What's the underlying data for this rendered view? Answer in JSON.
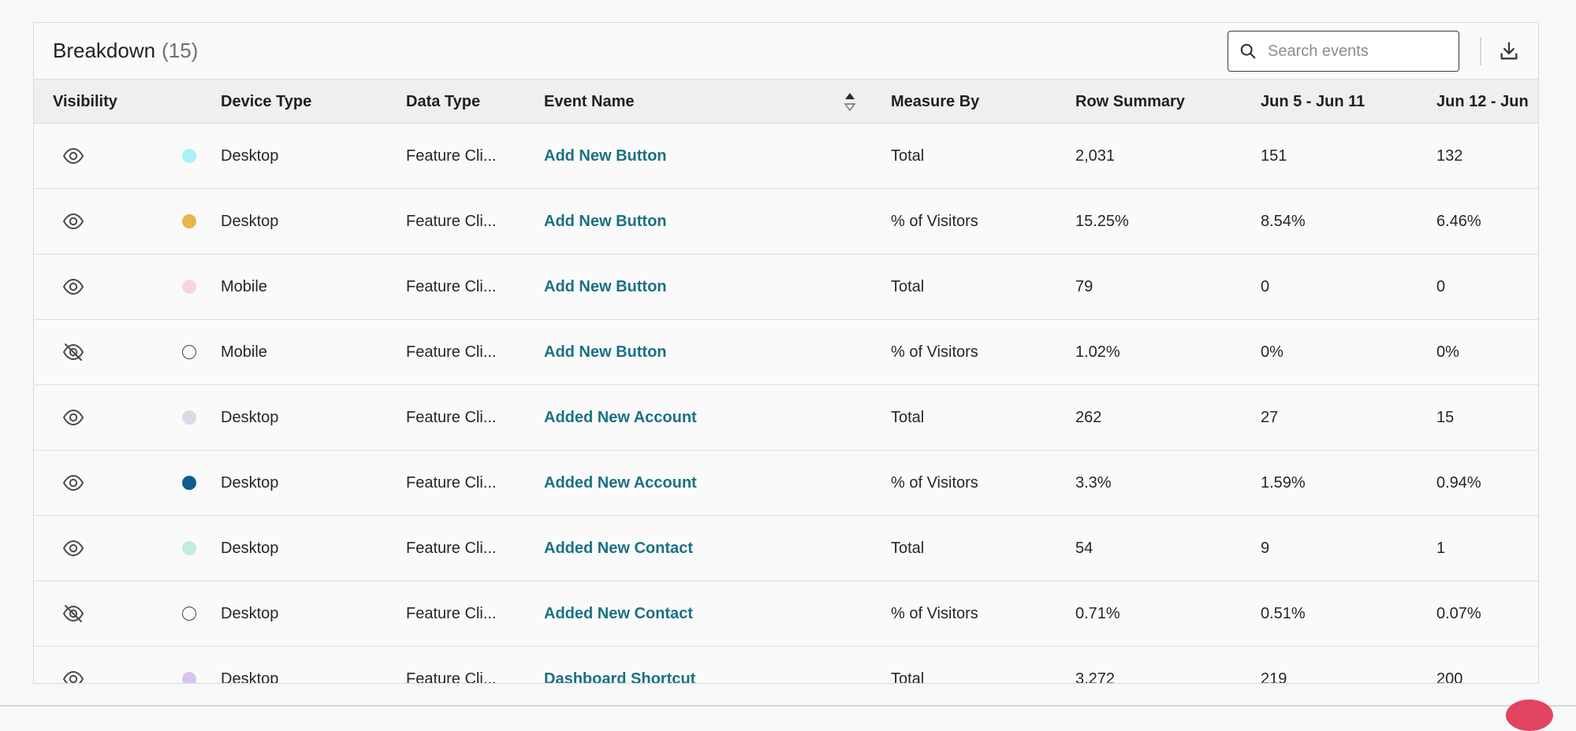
{
  "header": {
    "title": "Breakdown",
    "count": "(15)",
    "search_placeholder": "Search events",
    "search_value": ""
  },
  "columns": {
    "visibility": "Visibility",
    "device_type": "Device Type",
    "data_type": "Data Type",
    "event_name": "Event Name",
    "measure_by": "Measure By",
    "row_summary": "Row Summary",
    "week1": "Jun 5 - Jun 11",
    "week2": "Jun 12 - Jun"
  },
  "icons": {
    "search": "search-icon",
    "download": "download-icon",
    "sort": "sort-icon",
    "visible": "eye-icon",
    "hidden": "eye-off-icon"
  },
  "colors": {
    "link": "#1a7182",
    "header_bg": "#eeeff1"
  },
  "rows": [
    {
      "visible": true,
      "color": "#a8f2f7",
      "hollow": false,
      "device": "Desktop",
      "data_type": "Feature Cli...",
      "event": "Add New Button",
      "measure": "Total",
      "summary": "2,031",
      "w1": "151",
      "w2": "132"
    },
    {
      "visible": true,
      "color": "#e9b54a",
      "hollow": false,
      "device": "Desktop",
      "data_type": "Feature Cli...",
      "event": "Add New Button",
      "measure": "% of Visitors",
      "summary": "15.25%",
      "w1": "8.54%",
      "w2": "6.46%"
    },
    {
      "visible": true,
      "color": "#f6d5d8",
      "hollow": false,
      "device": "Mobile",
      "data_type": "Feature Cli...",
      "event": "Add New Button",
      "measure": "Total",
      "summary": "79",
      "w1": "0",
      "w2": "0"
    },
    {
      "visible": false,
      "color": "",
      "hollow": true,
      "device": "Mobile",
      "data_type": "Feature Cli...",
      "event": "Add New Button",
      "measure": "% of Visitors",
      "summary": "1.02%",
      "w1": "0%",
      "w2": "0%"
    },
    {
      "visible": true,
      "color": "#dad9e6",
      "hollow": false,
      "device": "Desktop",
      "data_type": "Feature Cli...",
      "event": "Added New Account",
      "measure": "Total",
      "summary": "262",
      "w1": "27",
      "w2": "15"
    },
    {
      "visible": true,
      "color": "#0f5d8c",
      "hollow": false,
      "device": "Desktop",
      "data_type": "Feature Cli...",
      "event": "Added New Account",
      "measure": "% of Visitors",
      "summary": "3.3%",
      "w1": "1.59%",
      "w2": "0.94%"
    },
    {
      "visible": true,
      "color": "#c5ebdc",
      "hollow": false,
      "device": "Desktop",
      "data_type": "Feature Cli...",
      "event": "Added New Contact",
      "measure": "Total",
      "summary": "54",
      "w1": "9",
      "w2": "1"
    },
    {
      "visible": false,
      "color": "",
      "hollow": true,
      "device": "Desktop",
      "data_type": "Feature Cli...",
      "event": "Added New Contact",
      "measure": "% of Visitors",
      "summary": "0.71%",
      "w1": "0.51%",
      "w2": "0.07%"
    },
    {
      "visible": true,
      "color": "#d9c3f3",
      "hollow": false,
      "device": "Desktop",
      "data_type": "Feature Cli...",
      "event": "Dashboard Shortcut",
      "measure": "Total",
      "summary": "3,272",
      "w1": "219",
      "w2": "200"
    }
  ]
}
